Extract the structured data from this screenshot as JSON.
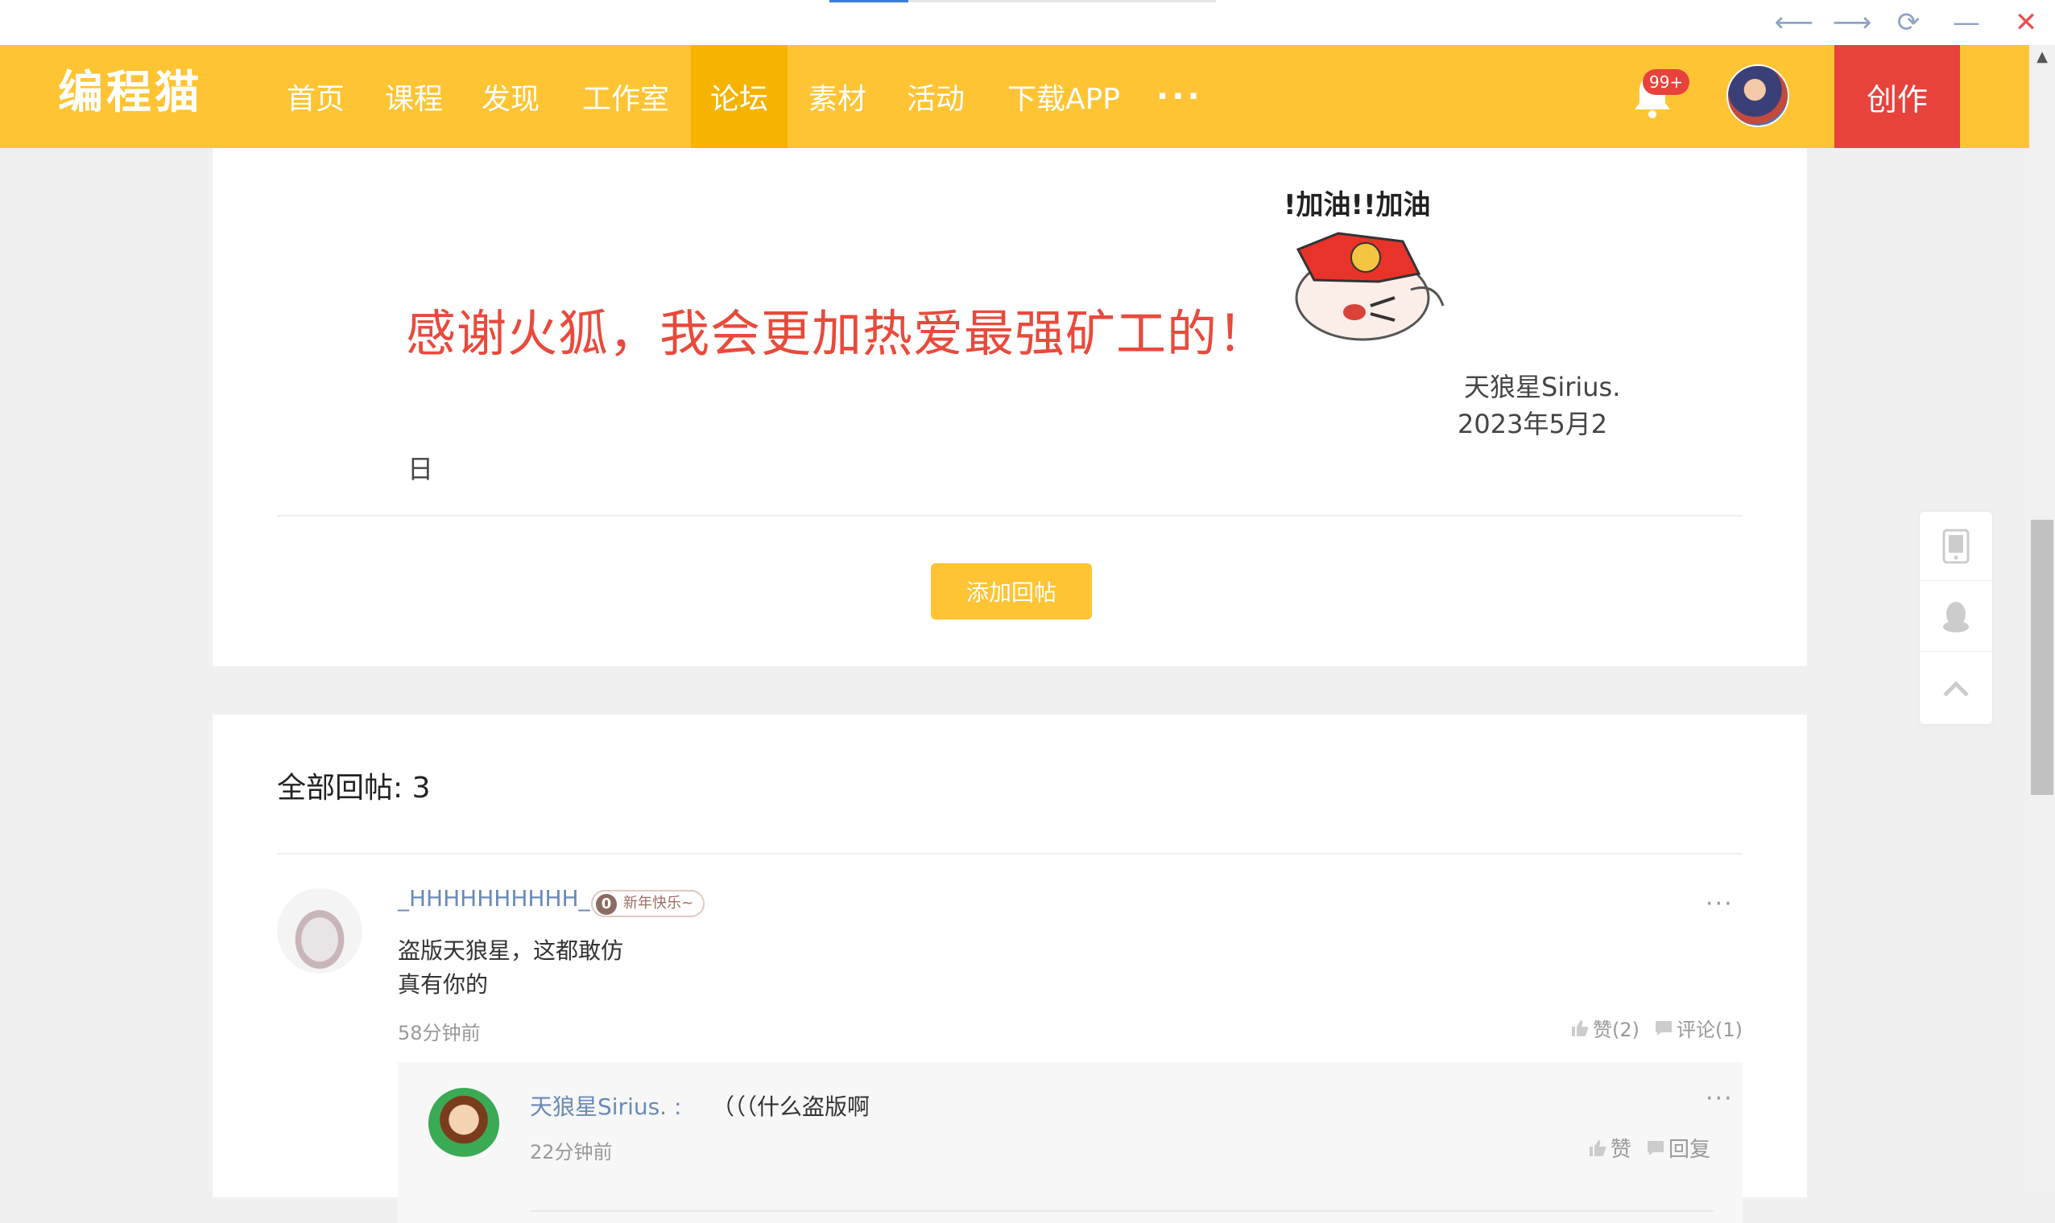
{
  "browser": {
    "back_icon": "arrow-left-icon",
    "forward_icon": "arrow-right-icon",
    "refresh_icon": "refresh-icon",
    "minimize_icon": "minimize-icon",
    "close_icon": "close-icon"
  },
  "nav": {
    "logo": "编程猫",
    "items": [
      "首页",
      "课程",
      "发现",
      "工作室",
      "论坛",
      "素材",
      "活动",
      "下载APP"
    ],
    "active_item": "论坛",
    "more": "···",
    "notification_badge": "99+",
    "create_label": "创作",
    "colors": {
      "bar": "#fec433",
      "active": "#f6b300",
      "create": "#e8423c"
    }
  },
  "post": {
    "thanks_text": "感谢火狐，我会更加热爱最强矿工的！",
    "sticker_text": "!加油!!加油",
    "signature_name": "天狼星Sirius.",
    "signature_date_part1": "2023年5月2",
    "signature_date_part2": "日",
    "add_reply_label": "添加回帖"
  },
  "replies": {
    "header": "全部回帖: 3",
    "items": [
      {
        "user": "_HHHHHHHHHH_",
        "level": "0",
        "tag": "新年快乐~",
        "lines": [
          "盗版天狼星，这都敢仿",
          "真有你的"
        ],
        "time": "58分钟前",
        "like_label": "赞(2)",
        "comment_label": "评论(1)",
        "more": "···",
        "comments": [
          {
            "user": "天狼星Sirius.",
            "separator": ":",
            "text": "（（（什么盗版啊",
            "time": "22分钟前",
            "like_label": "赞",
            "reply_label": "回复",
            "more": "···"
          }
        ]
      }
    ]
  }
}
